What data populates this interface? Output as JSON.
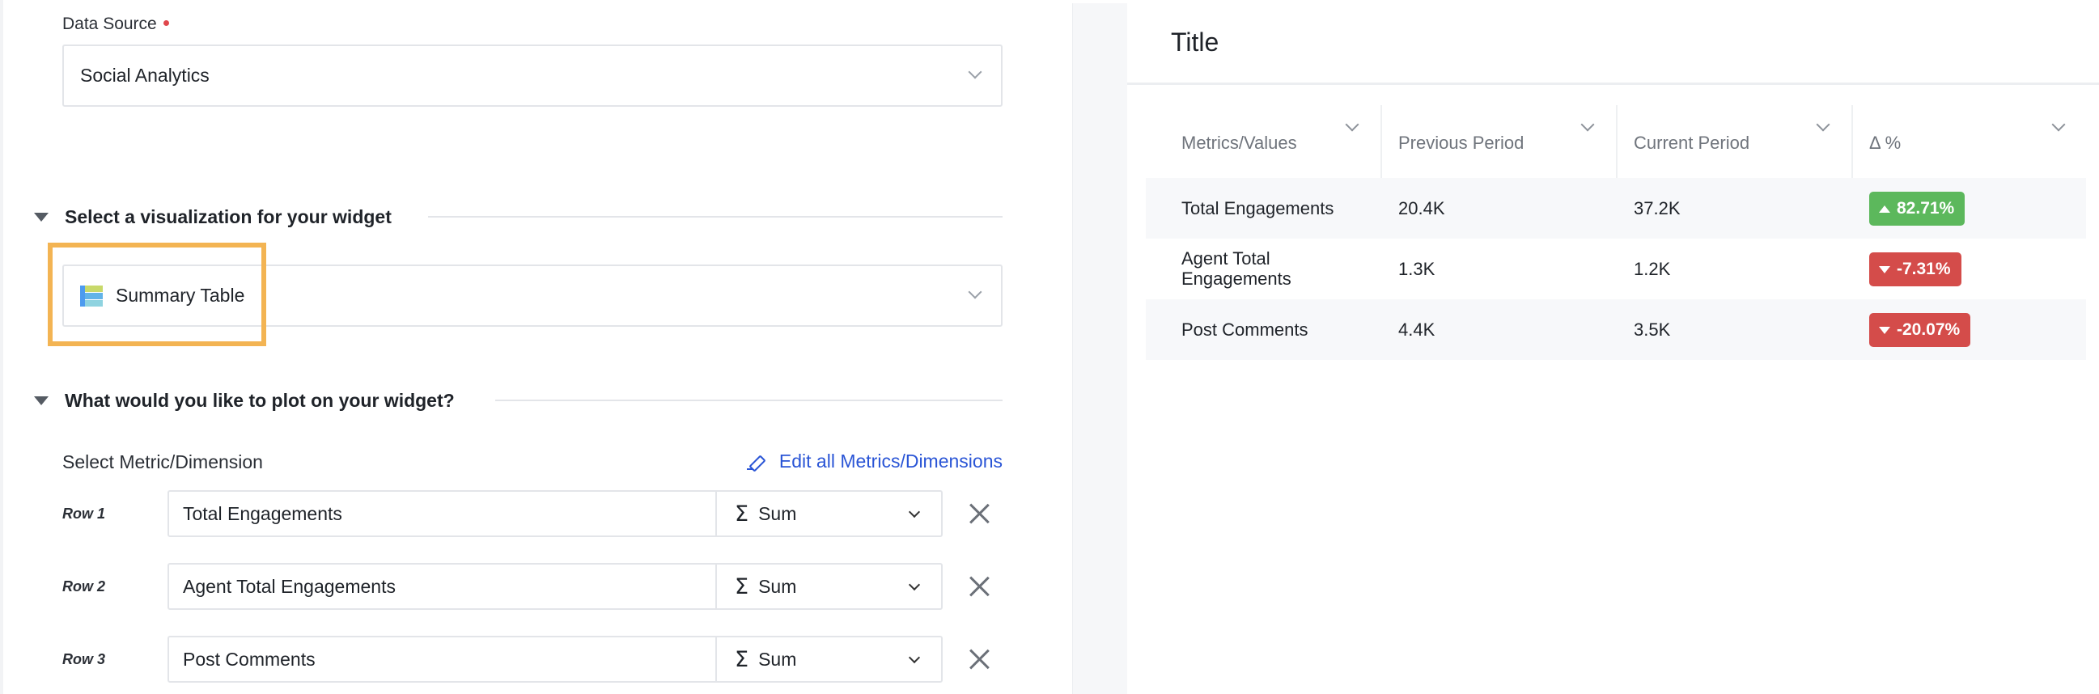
{
  "form": {
    "data_source": {
      "label": "Data Source",
      "required": true,
      "value": "Social Analytics"
    },
    "visualization_section": {
      "title": "Select a visualization for your widget",
      "selected_value": "Summary Table",
      "icon": "summary-table-icon"
    },
    "plot_section": {
      "title": "What would you like to plot on your widget?",
      "metric_label": "Select Metric/Dimension",
      "edit_all_link": "Edit all Metrics/Dimensions",
      "rows": [
        {
          "label": "Row 1",
          "metric": "Total Engagements",
          "aggregation": "Sum",
          "aggregation_icon": "Σ"
        },
        {
          "label": "Row 2",
          "metric": "Agent Total Engagements",
          "aggregation": "Sum",
          "aggregation_icon": "Σ"
        },
        {
          "label": "Row 3",
          "metric": "Post Comments",
          "aggregation": "Sum",
          "aggregation_icon": "Σ"
        }
      ]
    }
  },
  "preview": {
    "title": "Title",
    "table": {
      "columns": [
        "Metrics/Values",
        "Previous Period",
        "Current Period",
        "Δ %"
      ],
      "rows": [
        {
          "metric": "Total Engagements",
          "previous": "20.4K",
          "current": "37.2K",
          "delta": "82.71%",
          "direction": "up"
        },
        {
          "metric": "Agent Total Engagements",
          "previous": "1.3K",
          "current": "1.2K",
          "delta": "-7.31%",
          "direction": "down"
        },
        {
          "metric": "Post Comments",
          "previous": "4.4K",
          "current": "3.5K",
          "delta": "-20.07%",
          "direction": "down"
        }
      ]
    }
  },
  "colors": {
    "highlight": "#f3b453",
    "link": "#2a55d6",
    "positive": "#5cb85c",
    "negative": "#d44c4a",
    "required": "#e0474c"
  }
}
